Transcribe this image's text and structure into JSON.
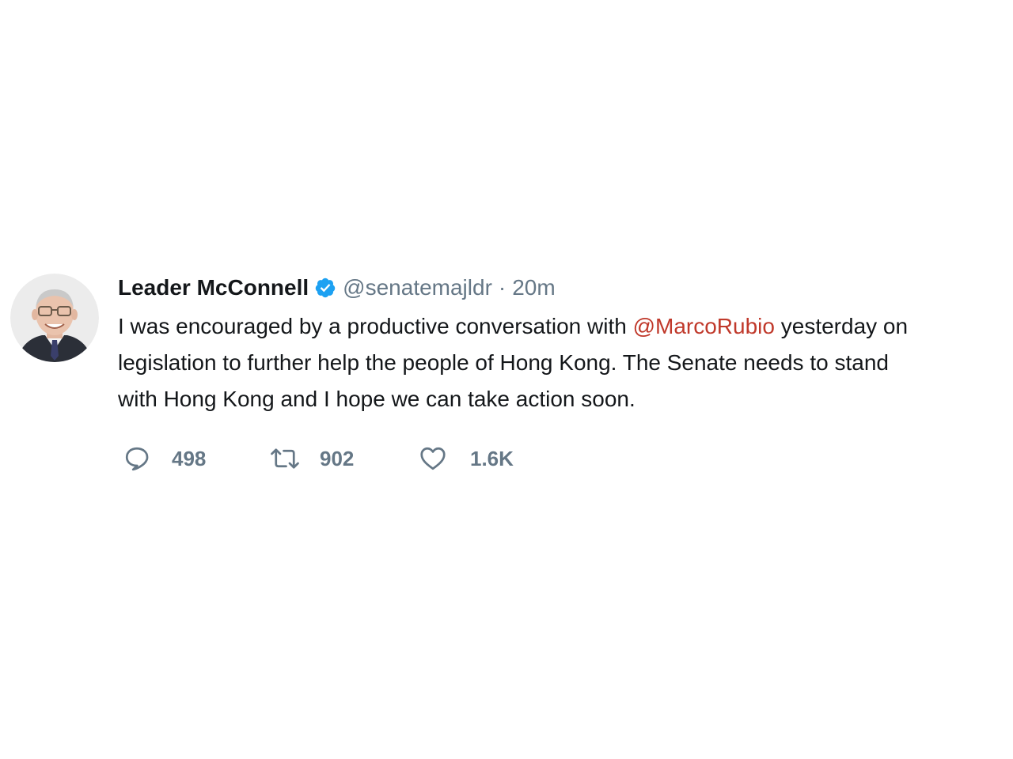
{
  "tweet": {
    "author": {
      "display_name": "Leader McConnell",
      "handle": "@senatemajldr",
      "verified": true
    },
    "separator": "·",
    "timestamp": "20m",
    "text": {
      "line1_pre": "I was encouraged by a productive conversation with ",
      "mention": "@MarcoRubio",
      "line1_post": " yesterday on",
      "line2": "legislation to further help the people of Hong Kong. The Senate needs to stand",
      "line3": "with Hong Kong and I hope we can take action soon."
    },
    "actions": {
      "reply_count": "498",
      "retweet_count": "902",
      "like_count": "1.6K"
    }
  },
  "icons": {
    "reply": "speech-bubble-icon",
    "retweet": "retweet-arrows-icon",
    "like": "heart-outline-icon",
    "verified": "verified-check-icon"
  },
  "colors": {
    "verified": "#1da1f2",
    "mention": "#c0392b",
    "muted": "#657786",
    "text": "#14171a"
  }
}
